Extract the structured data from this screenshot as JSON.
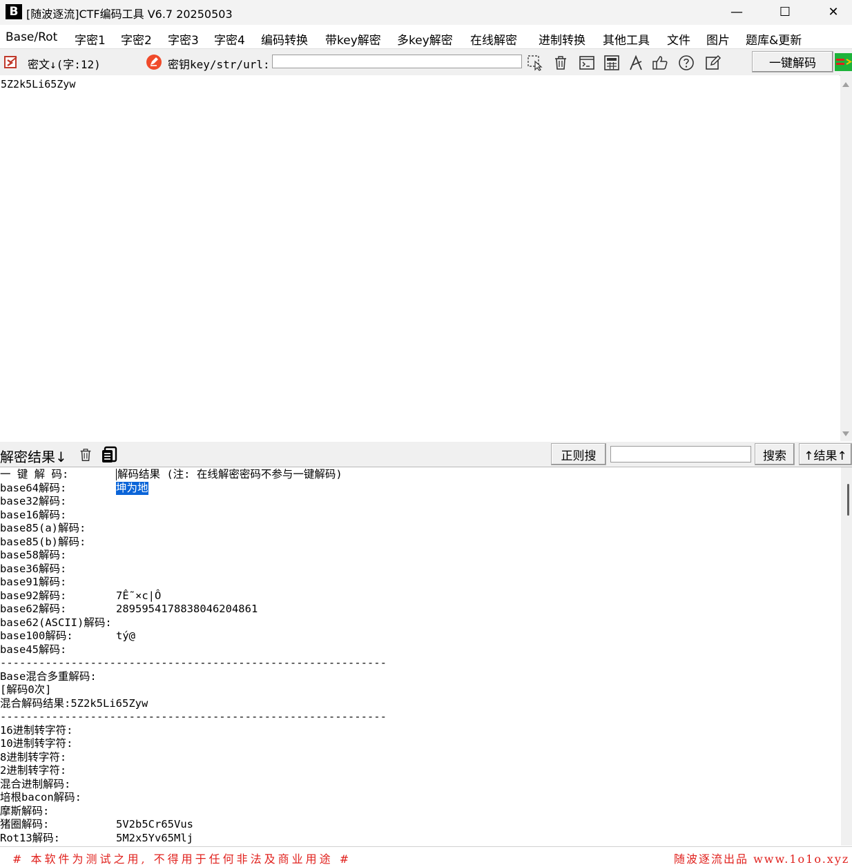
{
  "window": {
    "title": "[随波逐流]CTF编码工具 V6.7  20250503",
    "logo_text": "B",
    "minimize_glyph": "—",
    "maximize_glyph": "☐",
    "close_glyph": "✕"
  },
  "menu": [
    "Base/Rot",
    "字密1",
    "字密2",
    "字密3",
    "字密4",
    "编码转换",
    "带key解密",
    "多key解密",
    "在线解密",
    "进制转换",
    "其他工具",
    "文件",
    "图片",
    "题库&更新"
  ],
  "toolbar": {
    "cipher_label": "密文↓(字:12)",
    "key_label": "密钥key/str/url:",
    "key_value": "",
    "decode_button": "一键解码",
    "icons": [
      "cursor-select-icon",
      "trash-icon",
      "terminal-icon",
      "calculator-icon",
      "font-icon",
      "thumbs-up-icon",
      "help-icon",
      "edit-icon"
    ]
  },
  "cipher": {
    "text": "5Z2k5Li65Zyw"
  },
  "result_bar": {
    "label": "解密结果↓",
    "regex_button": "正则搜",
    "search_value": "",
    "search_button": "搜索",
    "result_up_button": "↑结果↑"
  },
  "results": [
    {
      "label": "一 键 解 码:",
      "value": "解码结果 (注: 在线解密密码不参与一键解码)",
      "caret": true
    },
    {
      "label": "base64解码:",
      "value": "坤为地",
      "highlight": true
    },
    {
      "label": "base32解码:",
      "value": ""
    },
    {
      "label": "base16解码:",
      "value": ""
    },
    {
      "label": "base85(a)解码:",
      "value": ""
    },
    {
      "label": "base85(b)解码:",
      "value": ""
    },
    {
      "label": "base58解码:",
      "value": ""
    },
    {
      "label": "base36解码:",
      "value": ""
    },
    {
      "label": "base91解码:",
      "value": ""
    },
    {
      "label": "base92解码:",
      "value": "7Ê˜×c|Ô"
    },
    {
      "label": "base62解码:",
      "value": "2895954178838046204861"
    },
    {
      "label": "base62(ASCII)解码:",
      "value": ""
    },
    {
      "label": "base100解码:",
      "value": "tý@"
    },
    {
      "label": "base45解码:",
      "value": ""
    },
    {
      "label": "------------------------------------------------------------",
      "value": ""
    },
    {
      "label": "Base混合多重解码:",
      "value": ""
    },
    {
      "label": "[解码0次]",
      "value": ""
    },
    {
      "label": "混合解码结果:5Z2k5Li65Zyw",
      "value": ""
    },
    {
      "label": "------------------------------------------------------------",
      "value": ""
    },
    {
      "label": "16进制转字符:",
      "value": ""
    },
    {
      "label": "10进制转字符:",
      "value": ""
    },
    {
      "label": "8进制转字符:",
      "value": ""
    },
    {
      "label": "2进制转字符:",
      "value": ""
    },
    {
      "label": "混合进制解码:",
      "value": ""
    },
    {
      "label": "培根bacon解码:",
      "value": ""
    },
    {
      "label": "摩斯解码:",
      "value": ""
    },
    {
      "label": "猪圈解码:",
      "value": "5V2b5Cr65Vus"
    },
    {
      "label": "Rot13解码:",
      "value": "5M2x5Yv65Mlj"
    }
  ],
  "footer": {
    "left": "# 本软件为测试之用, 不得用于任何非法及商业用途 #",
    "right": "随波逐流出品 www.1o1o.xyz"
  },
  "colors": {
    "footer_red": "#e0201c",
    "highlight_blue": "#0a64d8"
  }
}
